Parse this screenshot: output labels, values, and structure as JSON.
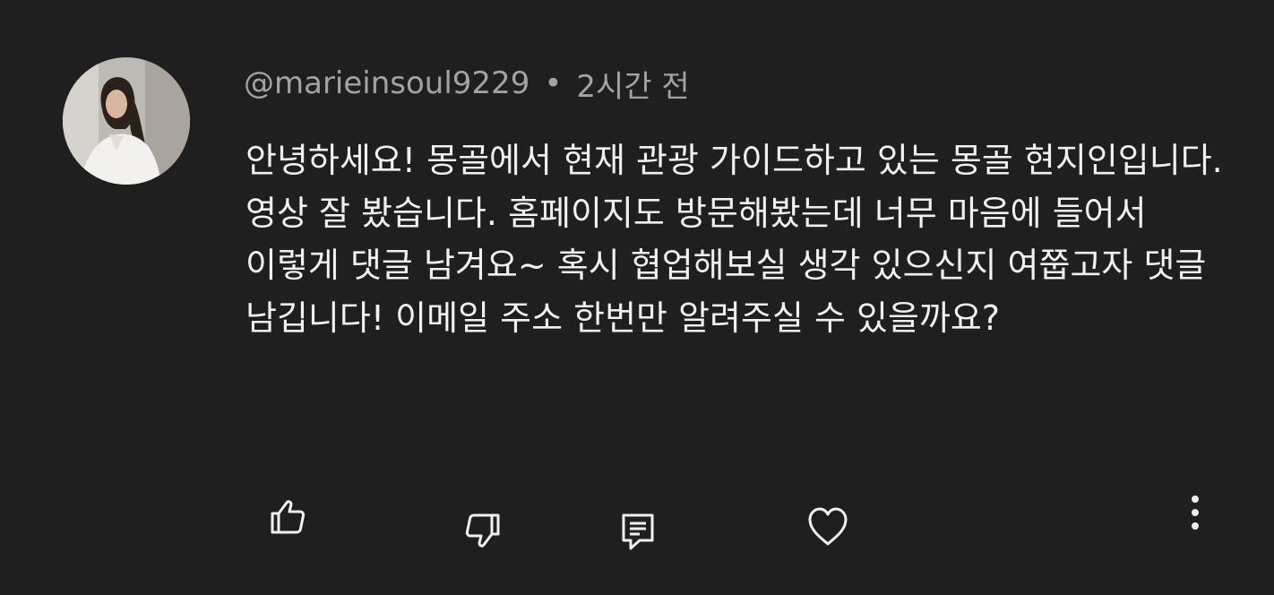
{
  "comment": {
    "author": "@marieinsoul9229",
    "separator": "•",
    "timestamp": "2시간 전",
    "text": "안녕하세요! 몽골에서 현재 관광 가이드하고 있는 몽골 현지인입니다.영상 잘 봤습니다. 홈페이지도 방문해봤는데 너무 마음에 들어서 이렇게 댓글 남겨요~ 혹시 협업해보실 생각 있으신지 여쭙고자 댓글 남깁니다! 이메일 주소 한번만 알려주실 수 있을까요?"
  },
  "actions": {
    "like_icon": "thumbs-up-icon",
    "dislike_icon": "thumbs-down-icon",
    "reply_icon": "reply-icon",
    "heart_icon": "heart-icon",
    "more_icon": "more-vertical-icon"
  },
  "theme": {
    "background": "#1f1f1f",
    "text": "#f1f1f1",
    "secondary_text": "#a3a3a3"
  }
}
